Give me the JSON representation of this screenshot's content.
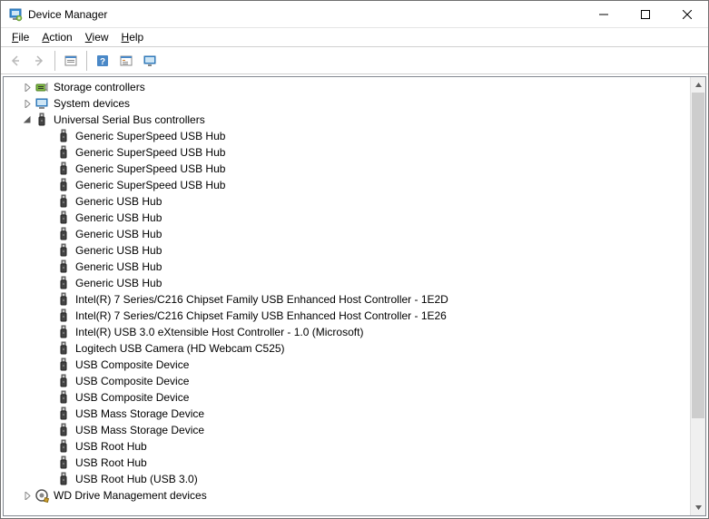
{
  "window": {
    "title": "Device Manager"
  },
  "menu": {
    "file": "File",
    "action": "Action",
    "view": "View",
    "help": "Help"
  },
  "toolbar": {
    "back": "back",
    "forward": "forward",
    "props": "show-hide-console",
    "help_btn": "help",
    "uninstall": "properties-box",
    "new_window": "monitor"
  },
  "tree": {
    "level1_indent": 18,
    "level2_indent": 38,
    "level3_indent": 58,
    "nodes": [
      {
        "expand": "collapsed",
        "icon": "storage-controller-icon",
        "label": "Storage controllers",
        "depth": 1,
        "children": []
      },
      {
        "expand": "collapsed",
        "icon": "system-devices-icon",
        "label": "System devices",
        "depth": 1,
        "children": []
      },
      {
        "expand": "expanded",
        "icon": "usb-icon",
        "label": "Universal Serial Bus controllers",
        "depth": 1,
        "children": [
          {
            "icon": "usb-icon",
            "label": "Generic SuperSpeed USB Hub"
          },
          {
            "icon": "usb-icon",
            "label": "Generic SuperSpeed USB Hub"
          },
          {
            "icon": "usb-icon",
            "label": "Generic SuperSpeed USB Hub"
          },
          {
            "icon": "usb-icon",
            "label": "Generic SuperSpeed USB Hub"
          },
          {
            "icon": "usb-icon",
            "label": "Generic USB Hub"
          },
          {
            "icon": "usb-icon",
            "label": "Generic USB Hub"
          },
          {
            "icon": "usb-icon",
            "label": "Generic USB Hub"
          },
          {
            "icon": "usb-icon",
            "label": "Generic USB Hub"
          },
          {
            "icon": "usb-icon",
            "label": "Generic USB Hub"
          },
          {
            "icon": "usb-icon",
            "label": "Generic USB Hub"
          },
          {
            "icon": "usb-icon",
            "label": "Intel(R) 7 Series/C216 Chipset Family USB Enhanced Host Controller - 1E2D"
          },
          {
            "icon": "usb-icon",
            "label": "Intel(R) 7 Series/C216 Chipset Family USB Enhanced Host Controller - 1E26"
          },
          {
            "icon": "usb-icon",
            "label": "Intel(R) USB 3.0 eXtensible Host Controller - 1.0 (Microsoft)"
          },
          {
            "icon": "usb-icon",
            "label": "Logitech USB Camera (HD Webcam C525)"
          },
          {
            "icon": "usb-icon",
            "label": "USB Composite Device"
          },
          {
            "icon": "usb-icon",
            "label": "USB Composite Device"
          },
          {
            "icon": "usb-icon",
            "label": "USB Composite Device"
          },
          {
            "icon": "usb-icon",
            "label": "USB Mass Storage Device"
          },
          {
            "icon": "usb-icon",
            "label": "USB Mass Storage Device"
          },
          {
            "icon": "usb-icon",
            "label": "USB Root Hub"
          },
          {
            "icon": "usb-icon",
            "label": "USB Root Hub"
          },
          {
            "icon": "usb-icon",
            "label": "USB Root Hub (USB 3.0)"
          }
        ]
      },
      {
        "expand": "collapsed",
        "icon": "wd-icon",
        "label": "WD Drive Management devices",
        "depth": 1,
        "children": []
      }
    ]
  }
}
